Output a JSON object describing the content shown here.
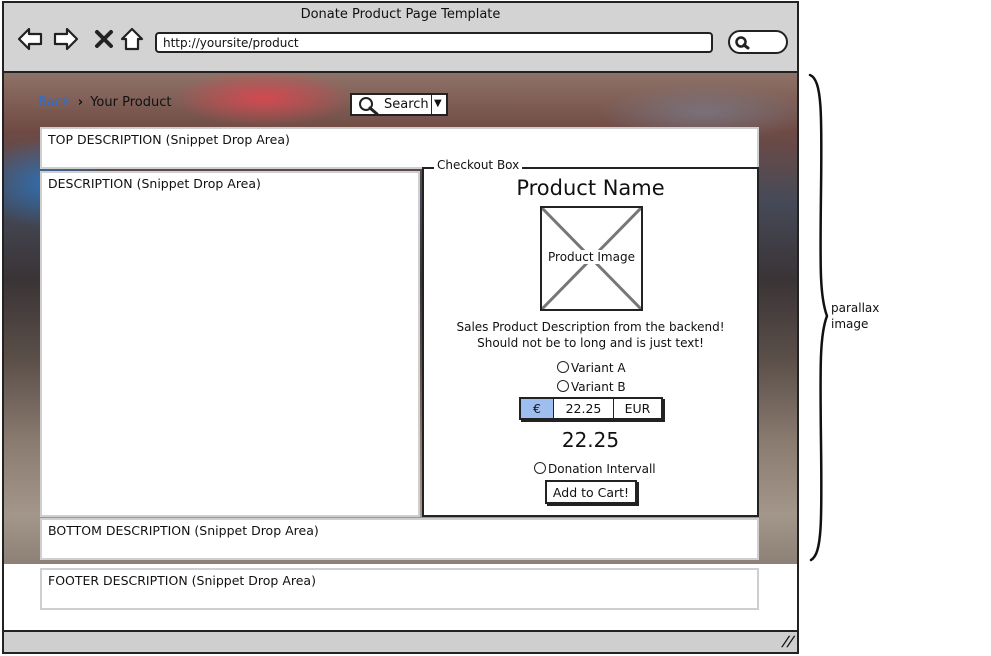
{
  "window": {
    "title": "Donate Product Page Template",
    "url": "http://yoursite/product"
  },
  "icons": {
    "back": "arrow-left-icon",
    "forward": "arrow-right-icon",
    "stop": "close-icon",
    "home": "home-icon",
    "search": "search-icon",
    "dropdown": "chevron-down-icon",
    "resize": "resize-grip-icon"
  },
  "breadcrumb": {
    "back": "Back",
    "current": "Your Product"
  },
  "search": {
    "label": "Search"
  },
  "areas": {
    "top": "TOP DESCRIPTION (Snippet Drop Area)",
    "description": "DESCRIPTION (Snippet Drop Area)",
    "bottom": "BOTTOM DESCRIPTION (Snippet Drop Area)",
    "footer": "FOOTER DESCRIPTION (Snippet Drop Area)"
  },
  "checkout": {
    "legend": "Checkout Box",
    "product_name": "Product Name",
    "image_label": "Product Image",
    "description_line1": "Sales Product Description from the backend!",
    "description_line2": "Should not be to long and is just text!",
    "variants": [
      "Variant A",
      "Variant B"
    ],
    "currency_symbol": "€",
    "amount": "22.25",
    "currency_code": "EUR",
    "price": "22.25",
    "interval_label": "Donation Intervall",
    "add_to_cart": "Add to Cart!"
  },
  "annotation": {
    "line1": "parallax",
    "line2": "image"
  },
  "colors": {
    "chrome": "#d3d3d3",
    "link": "#2a6fd6",
    "selected_currency": "#9fbef0",
    "drop_area_border": "#cfcfcf"
  }
}
